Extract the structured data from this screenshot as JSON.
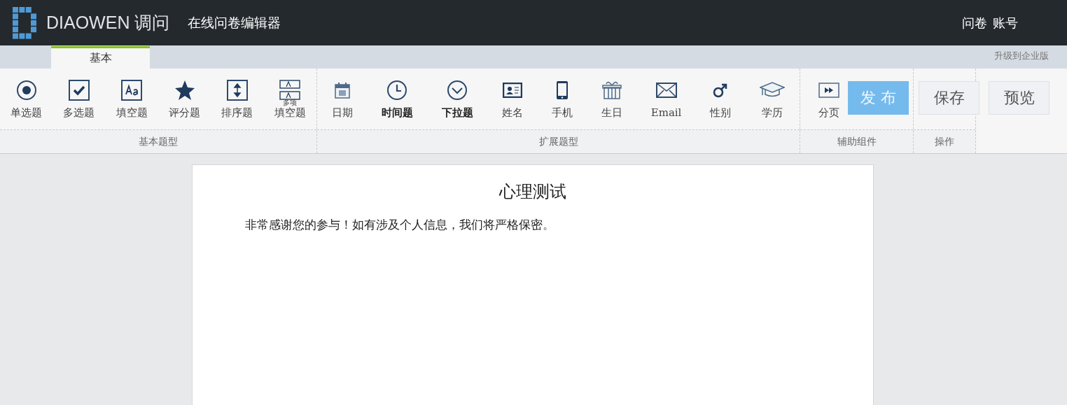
{
  "header": {
    "logo_text": "DIAOWEN 调问",
    "title": "在线问卷编辑器",
    "links": [
      "问卷",
      "账号"
    ]
  },
  "tabs": [
    {
      "label": "基本",
      "selected": true
    }
  ],
  "upgrade_link": "升级到企业版",
  "groups": [
    {
      "label": "基本题型",
      "tools": [
        {
          "kind": "radio",
          "label": "单选题",
          "bold": false
        },
        {
          "kind": "checkbox",
          "label": "多选题",
          "bold": false
        },
        {
          "kind": "text",
          "label": "填空题",
          "bold": false
        },
        {
          "kind": "star",
          "label": "评分题",
          "bold": false
        },
        {
          "kind": "sort",
          "label": "排序题",
          "bold": false
        },
        {
          "kind": "multitext",
          "label": "填空题",
          "super": "多项",
          "bold": false
        }
      ]
    },
    {
      "label": "扩展题型",
      "tools": [
        {
          "kind": "calendar",
          "label": "日期",
          "bold": false
        },
        {
          "kind": "clock",
          "label": "时间题",
          "bold": true
        },
        {
          "kind": "dropdown",
          "label": "下拉题",
          "bold": true
        },
        {
          "kind": "idcard",
          "label": "姓名",
          "bold": false
        },
        {
          "kind": "phone",
          "label": "手机",
          "bold": false
        },
        {
          "kind": "gift",
          "label": "生日",
          "bold": false
        },
        {
          "kind": "mail",
          "label": "Email",
          "bold": false
        },
        {
          "kind": "male",
          "label": "性别",
          "bold": false
        },
        {
          "kind": "cap",
          "label": "学历",
          "bold": false
        }
      ]
    },
    {
      "label": "辅助组件",
      "tools": [
        {
          "kind": "page",
          "label": "分页",
          "bold": false
        }
      ]
    },
    {
      "label": "操作"
    }
  ],
  "actions": [
    {
      "label": "发 布",
      "kind": "primary"
    },
    {
      "label": "保存",
      "kind": "plain"
    },
    {
      "label": "预览",
      "kind": "plain"
    }
  ],
  "survey": {
    "title": "心理测试",
    "intro": "非常感谢您的参与！如有涉及个人信息，我们将严格保密。"
  }
}
